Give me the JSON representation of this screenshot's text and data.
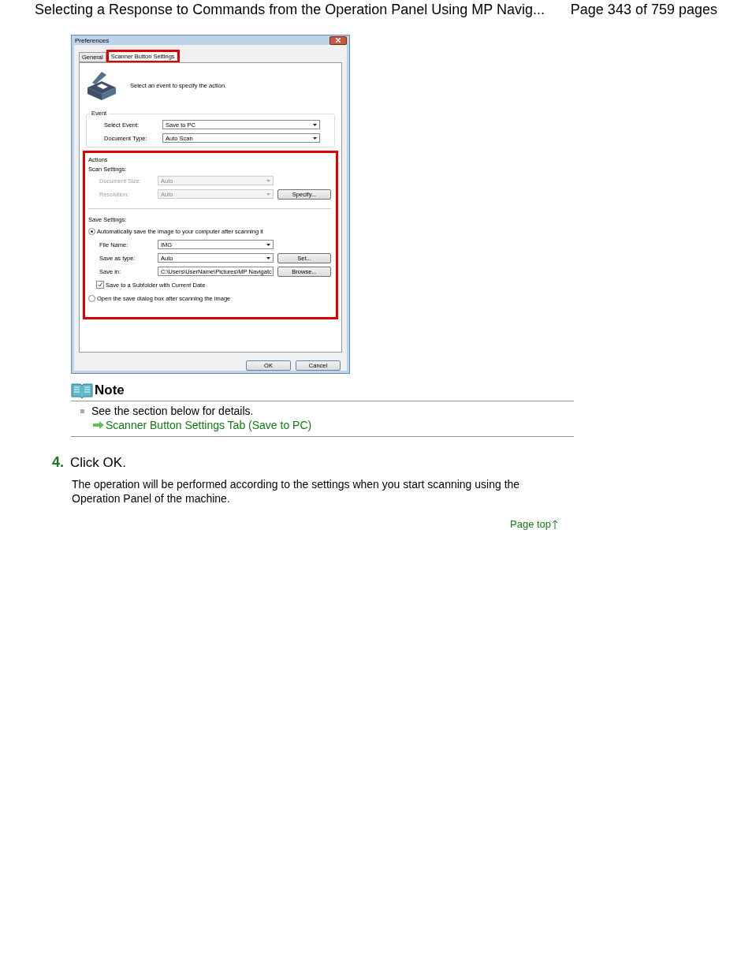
{
  "header": {
    "title": "Selecting a Response to Commands from the Operation Panel Using MP Navig...",
    "page": "Page 343 of 759 pages"
  },
  "dialog": {
    "title": "Preferences",
    "tabs": [
      {
        "label": "General",
        "selected": false
      },
      {
        "label": "Scanner Button Settings",
        "selected": true
      }
    ],
    "instruction": "Select an event to specify the action.",
    "event": {
      "legend": "Event",
      "rows": [
        {
          "label": "Select Event:",
          "value": "Save to PC",
          "kind": "dropdown",
          "disabled": false
        },
        {
          "label": "Document Type:",
          "value": "Auto Scan",
          "kind": "dropdown",
          "disabled": false
        }
      ]
    },
    "actions": {
      "legend": "Actions",
      "scan_label": "Scan Settings:",
      "scan_rows": [
        {
          "label": "Document Size:",
          "value": "Auto",
          "kind": "dropdown",
          "disabled": true
        },
        {
          "label": "Resolution:",
          "value": "Auto",
          "kind": "dropdown",
          "disabled": true,
          "button": "Specify..."
        }
      ],
      "save_label": "Save Settings:",
      "radios": [
        {
          "label": "Automatically save the image to your computer after scanning it",
          "selected": true
        },
        {
          "label": "Open the save dialog box after scanning the image",
          "selected": false
        }
      ],
      "save_rows": [
        {
          "label": "File Name:",
          "value": "IMG",
          "kind": "dropdown",
          "disabled": false
        },
        {
          "label": "Save as type:",
          "value": "Auto",
          "kind": "dropdown",
          "disabled": false,
          "button": "Set..."
        },
        {
          "label": "Save in:",
          "value": "C:\\Users\\UserName\\Pictures\\MP Navigatc",
          "kind": "text",
          "disabled": false,
          "button": "Browse..."
        }
      ],
      "checkbox": {
        "label": "Save to a Subfolder with Current Date",
        "checked": true
      }
    },
    "buttons": [
      "OK",
      "Cancel"
    ]
  },
  "note": {
    "title": "Note",
    "text": "See the section below for details.",
    "link": "Scanner Button Settings Tab (Save to PC)"
  },
  "step": {
    "number": "4.",
    "title": "Click OK.",
    "body": "The operation will be performed according to the settings when you start scanning using the Operation Panel of the machine."
  },
  "page_top": "Page top"
}
